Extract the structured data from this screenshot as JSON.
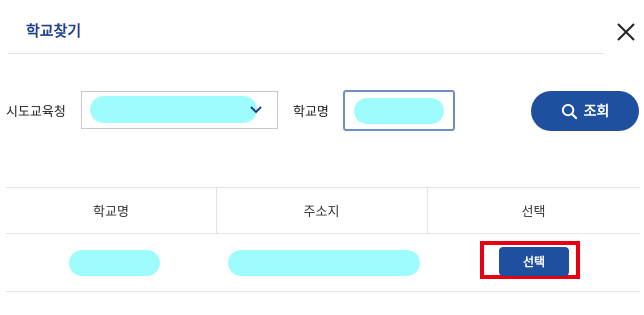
{
  "dialog": {
    "title": "학교찾기",
    "close_icon": "close-icon"
  },
  "search": {
    "sido_label": "시도교육청",
    "sido_value": "",
    "school_label": "학교명",
    "school_value": "",
    "search_button_label": "조회",
    "search_icon": "search-icon"
  },
  "table": {
    "headers": [
      "학교명",
      "주소지",
      "선택"
    ],
    "rows": [
      {
        "school": "",
        "address": "",
        "select_label": "선택"
      }
    ]
  },
  "colors": {
    "primary": "#1f4f9f",
    "title": "#1f3f8f",
    "highlight": "#e60012",
    "redaction": "#9ffcfc"
  }
}
